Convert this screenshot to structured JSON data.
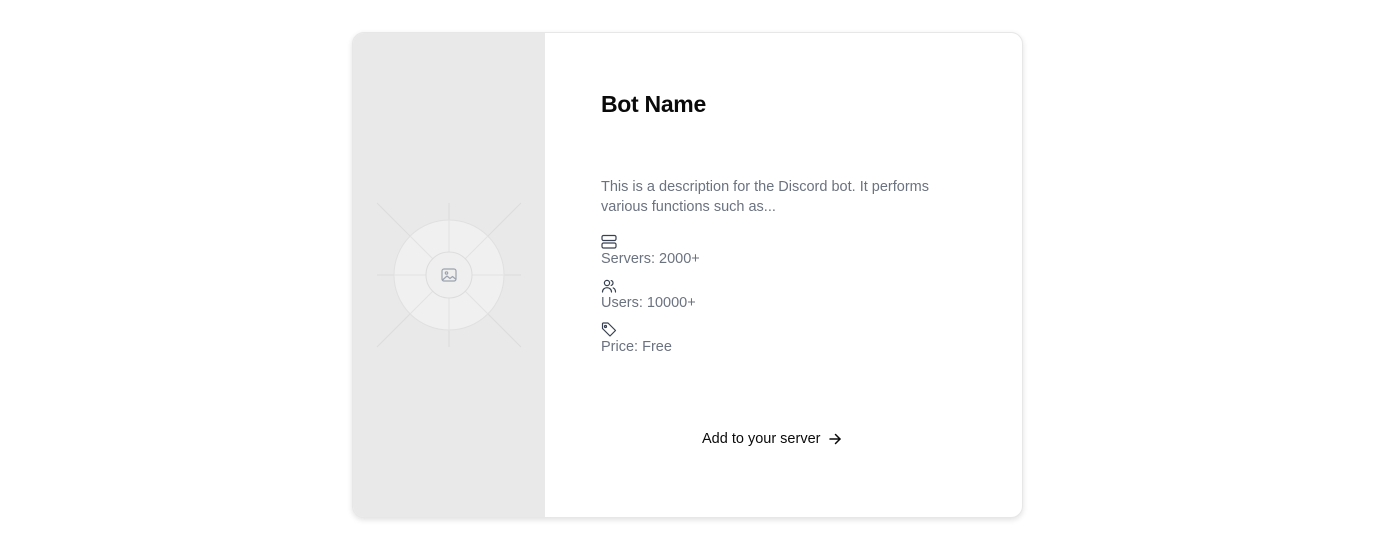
{
  "bot": {
    "name": "Bot Name",
    "description": "This is a description for the Discord bot. It performs various functions such as...",
    "image_icon": "image-placeholder-icon"
  },
  "stats": {
    "servers": {
      "icon": "server-icon",
      "label": "Servers: 2000+"
    },
    "users": {
      "icon": "users-icon",
      "label": "Users: 10000+"
    },
    "price": {
      "icon": "tag-icon",
      "label": "Price: Free"
    }
  },
  "cta": {
    "label": "Add to your server",
    "icon": "arrow-right-icon"
  },
  "colors": {
    "placeholder_bg": "#e9e9e9",
    "text_primary": "#0a0a0a",
    "text_muted": "#6b7280"
  }
}
